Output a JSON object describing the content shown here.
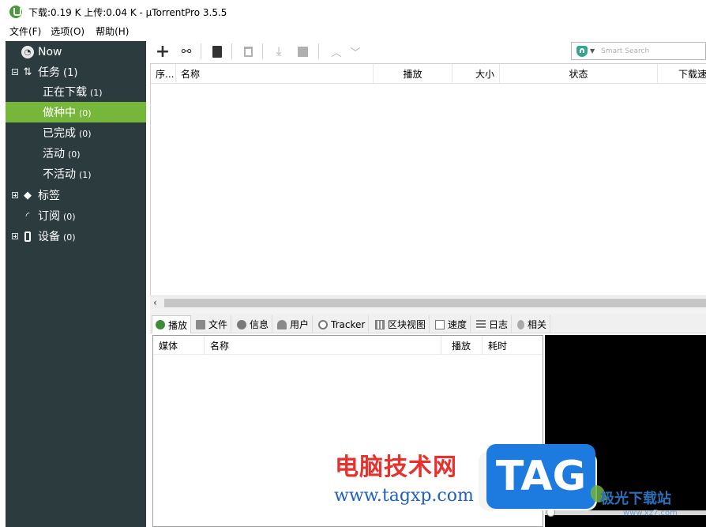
{
  "window": {
    "title": "下载:0.19 K 上传:0.04 K - µTorrentPro 3.5.5"
  },
  "menu": [
    {
      "label": "文件(F)"
    },
    {
      "label": "选项(O)"
    },
    {
      "label": "帮助(H)"
    }
  ],
  "sidebar": {
    "items": [
      {
        "label": "Now",
        "count": ""
      },
      {
        "label": "任务",
        "count": "(1)"
      },
      {
        "label": "正在下载",
        "count": "(1)"
      },
      {
        "label": "做种中",
        "count": "(0)"
      },
      {
        "label": "已完成",
        "count": "(0)"
      },
      {
        "label": "活动",
        "count": "(0)"
      },
      {
        "label": "不活动",
        "count": "(1)"
      },
      {
        "label": "标签",
        "count": ""
      },
      {
        "label": "订阅",
        "count": "(0)"
      },
      {
        "label": "设备",
        "count": "(0)"
      }
    ],
    "accent_color": "#76b63a"
  },
  "toolbar": {
    "search_placeholder": "Smart Search"
  },
  "torrent_list": {
    "columns": [
      "序...",
      "名称",
      "播放",
      "大小",
      "状态",
      "下载速"
    ]
  },
  "bottom_tabs": [
    {
      "label": "播放",
      "icon": "play-icon"
    },
    {
      "label": "文件",
      "icon": "file-icon"
    },
    {
      "label": "信息",
      "icon": "info-icon"
    },
    {
      "label": "用户",
      "icon": "users-icon"
    },
    {
      "label": "Tracker",
      "icon": "tracker-icon"
    },
    {
      "label": "区块视图",
      "icon": "pieces-icon"
    },
    {
      "label": "速度",
      "icon": "speed-icon"
    },
    {
      "label": "日志",
      "icon": "log-icon"
    },
    {
      "label": "相关",
      "icon": "related-icon"
    }
  ],
  "files_panel": {
    "columns": [
      "媒体",
      "名称",
      "播放",
      "耗时"
    ]
  },
  "watermark": {
    "brand_cn": "电脑技术网",
    "url": "www.tagxp.com",
    "tag": "TAG",
    "site2": "极光下载站",
    "site2_url": "www.xz7.com"
  }
}
